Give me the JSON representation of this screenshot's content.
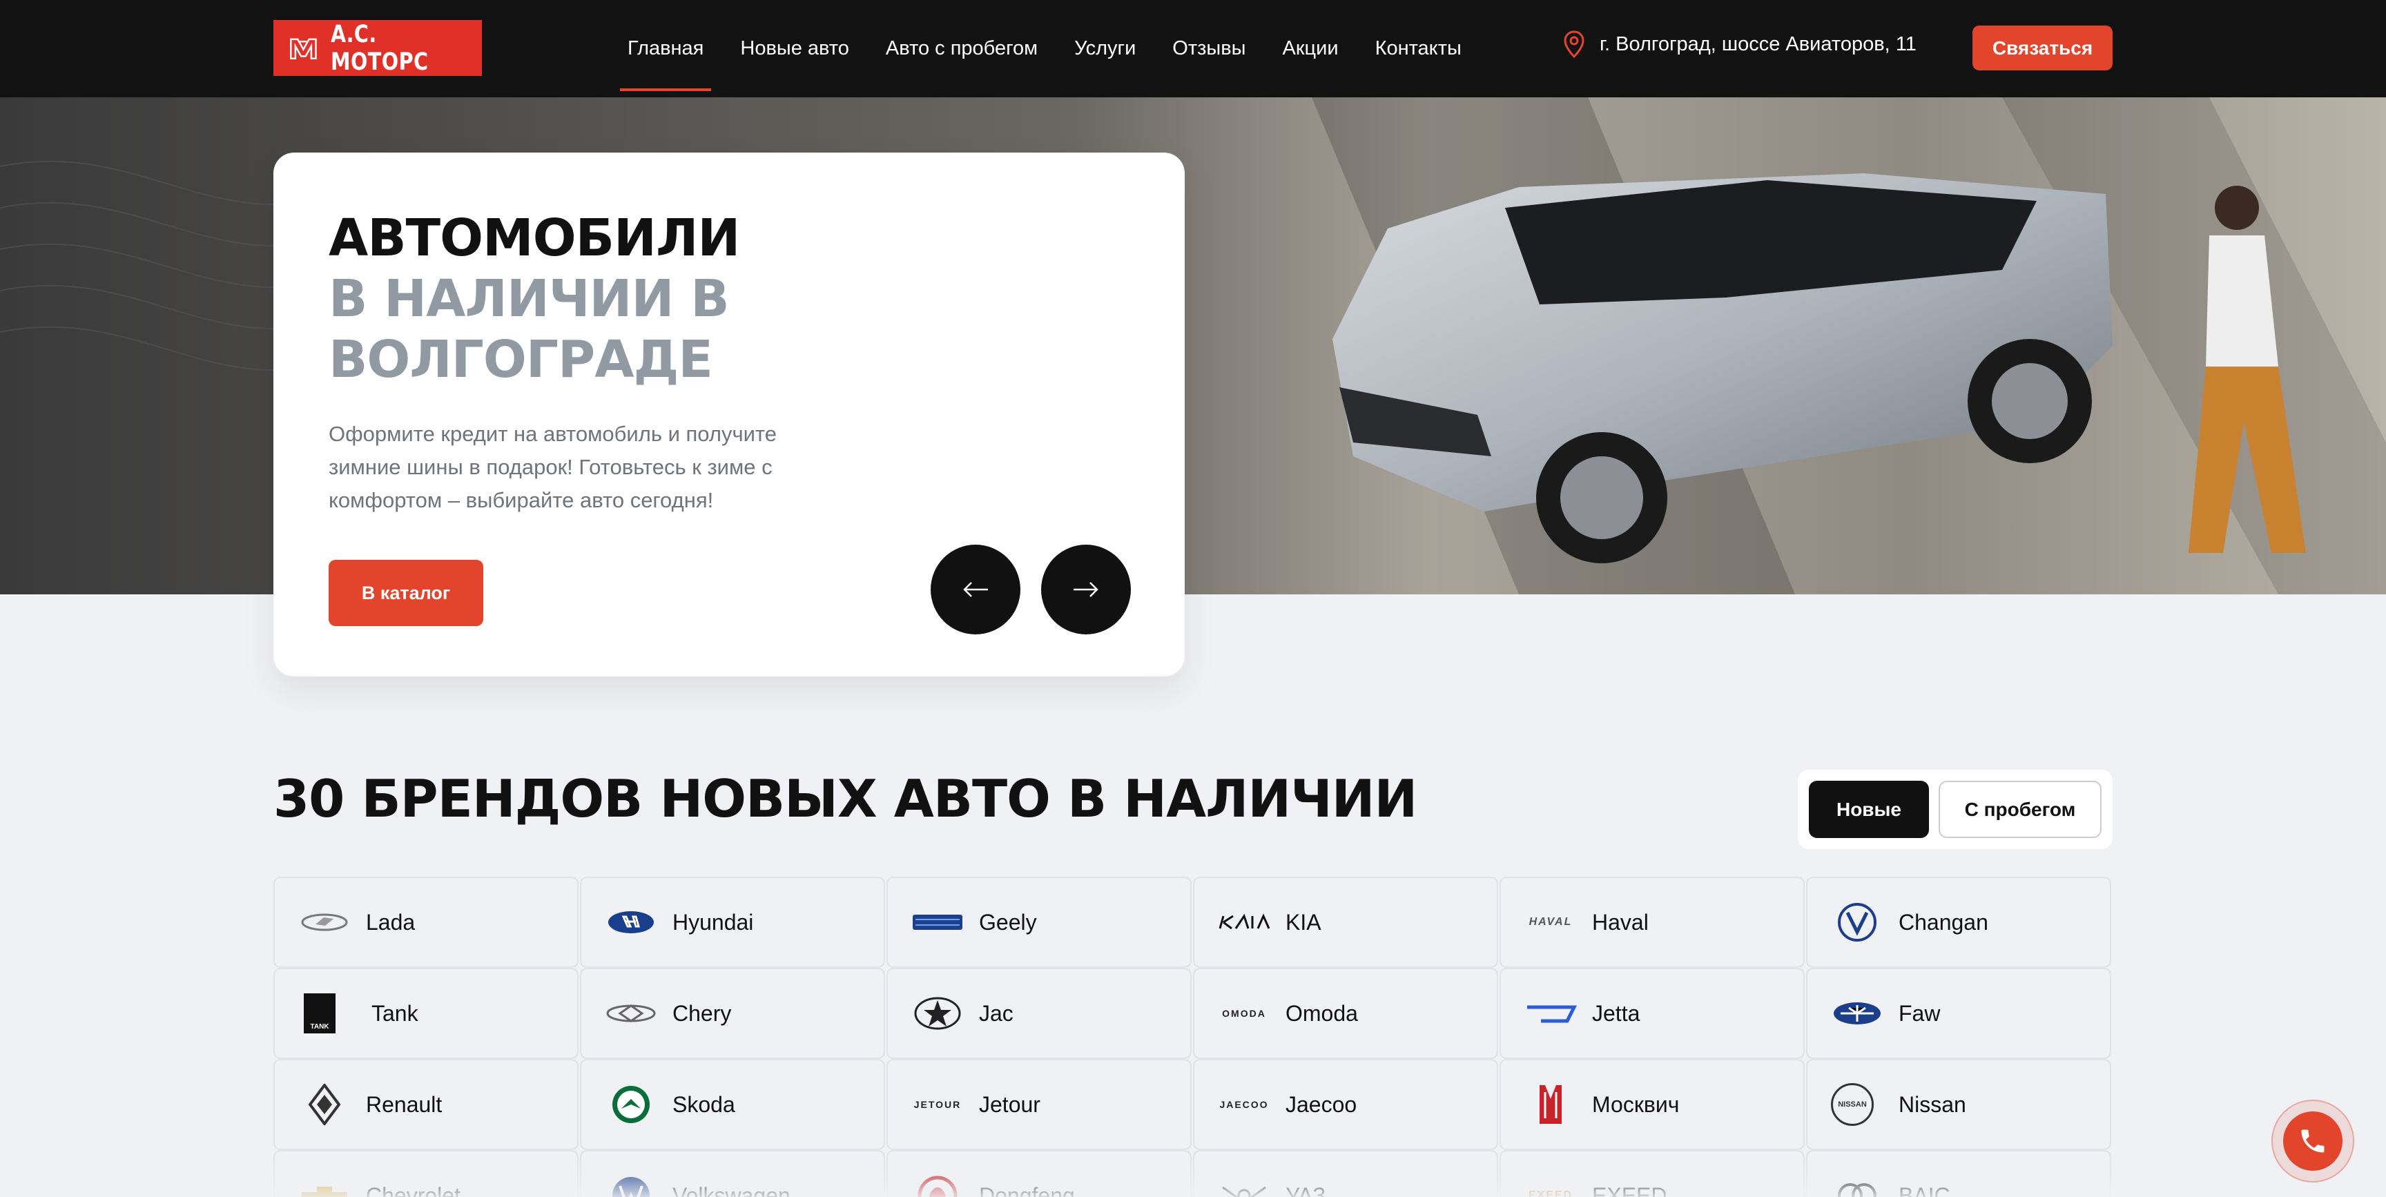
{
  "header": {
    "logo_text": "А.С. МОТОРС",
    "nav": [
      {
        "label": "Главная",
        "active": true
      },
      {
        "label": "Новые авто"
      },
      {
        "label": "Авто с пробегом"
      },
      {
        "label": "Услуги"
      },
      {
        "label": "Отзывы"
      },
      {
        "label": "Акции"
      },
      {
        "label": "Контакты"
      }
    ],
    "address": "г. Волгоград, шоссе Авиаторов, 11",
    "contact_label": "Связаться"
  },
  "hero": {
    "title_line1": "АВТОМОБИЛИ",
    "title_line2": "В НАЛИЧИИ В",
    "title_line3": "ВОЛГОГРАДЕ",
    "description": "Оформите кредит на автомобиль и получите зимние шины в подарок! Готовьтесь к зиме с комфортом – выбирайте авто сегодня!",
    "catalog_label": "В каталог"
  },
  "brands": {
    "title": "30 БРЕНДОВ НОВЫХ АВТО В НАЛИЧИИ",
    "toggle_new": "Новые",
    "toggle_used": "С пробегом",
    "items": [
      {
        "name": "Lada",
        "icon": "lada-logo"
      },
      {
        "name": "Hyundai",
        "icon": "hyundai-logo"
      },
      {
        "name": "Geely",
        "icon": "geely-logo"
      },
      {
        "name": "KIA",
        "icon": "kia-logo"
      },
      {
        "name": "Haval",
        "icon": "haval-logo",
        "logo_text": "HAVAL"
      },
      {
        "name": "Changan",
        "icon": "changan-logo"
      },
      {
        "name": "Tank",
        "icon": "tank-logo",
        "logo_text": "TANK"
      },
      {
        "name": "Chery",
        "icon": "chery-logo"
      },
      {
        "name": "Jac",
        "icon": "jac-logo"
      },
      {
        "name": "Omoda",
        "icon": "omoda-logo",
        "logo_text": "OMODA"
      },
      {
        "name": "Jetta",
        "icon": "jetta-logo"
      },
      {
        "name": "Faw",
        "icon": "faw-logo"
      },
      {
        "name": "Renault",
        "icon": "renault-logo"
      },
      {
        "name": "Skoda",
        "icon": "skoda-logo"
      },
      {
        "name": "Jetour",
        "icon": "jetour-logo",
        "logo_text": "JETOUR"
      },
      {
        "name": "Jaecoo",
        "icon": "jaecoo-logo",
        "logo_text": "JAECOO"
      },
      {
        "name": "Москвич",
        "icon": "moskvich-logo"
      },
      {
        "name": "Nissan",
        "icon": "nissan-logo",
        "logo_text": "NISSAN"
      },
      {
        "name": "Chevrolet",
        "icon": "chevrolet-logo"
      },
      {
        "name": "Volkswagen",
        "icon": "volkswagen-logo"
      },
      {
        "name": "Dongfeng",
        "icon": "dongfeng-logo"
      },
      {
        "name": "УАЗ",
        "icon": "uaz-logo"
      },
      {
        "name": "EXEED",
        "icon": "exeed-logo",
        "logo_text": "EXEED"
      },
      {
        "name": "BAIC",
        "icon": "baic-logo"
      }
    ]
  },
  "colors": {
    "accent": "#e2452b",
    "header_bg": "#121212",
    "page_bg": "#f0f1f4"
  }
}
